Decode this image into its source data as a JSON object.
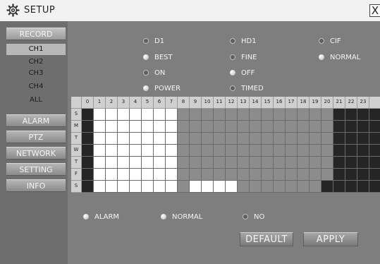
{
  "window": {
    "title": "SETUP",
    "close_glyph": "X"
  },
  "sidebar": {
    "record": "RECORD",
    "channels": [
      "CH1",
      "CH2",
      "CH3",
      "CH4",
      "ALL"
    ],
    "selected_channel": "CH1",
    "menu": [
      "ALARM",
      "PTZ",
      "NETWORK",
      "SETTING",
      "INFO"
    ]
  },
  "options": {
    "resolution": [
      {
        "label": "D1",
        "selected": false
      },
      {
        "label": "HD1",
        "selected": false
      },
      {
        "label": "CIF",
        "selected": false
      }
    ],
    "quality": [
      {
        "label": "BEST",
        "selected": true
      },
      {
        "label": "FINE",
        "selected": false
      },
      {
        "label": "NORMAL",
        "selected": true
      }
    ],
    "audio": [
      {
        "label": "ON",
        "selected": false
      },
      {
        "label": "OFF",
        "selected": true
      }
    ],
    "record_mode": [
      {
        "label": "POWER",
        "selected": true
      },
      {
        "label": "TIMED",
        "selected": false
      }
    ]
  },
  "schedule": {
    "hours": [
      "0",
      "1",
      "2",
      "3",
      "4",
      "5",
      "6",
      "7",
      "8",
      "9",
      "10",
      "11",
      "12",
      "13",
      "14",
      "15",
      "16",
      "17",
      "18",
      "19",
      "20",
      "21",
      "22",
      "23"
    ],
    "days": [
      "S",
      "M",
      "T",
      "W",
      "T",
      "F",
      "S"
    ],
    "rows": [
      "bwwwwwwwgggggggggggggbbbbb",
      "bwwwwwwwgggggggggggggbbbbb",
      "bwwwwwwwgggggggggggggbbbbb",
      "bwwwwwwwgggggggggggggbbbbb",
      "bwwwwwwwgggggggggggggbbbbb",
      "bwwwwwwwgggggggggggggbbbbb",
      "bwwwwwwwgwwwwgggggggbbbbbb"
    ]
  },
  "legend": [
    {
      "label": "ALARM",
      "selected": true
    },
    {
      "label": "NORMAL",
      "selected": true
    },
    {
      "label": "NO",
      "selected": false
    }
  ],
  "buttons": {
    "default": "DEFAULT",
    "apply": "APPLY"
  },
  "colors": {
    "alarm": "#252525",
    "normal": "#8c8c8c",
    "no": "#ffffff"
  },
  "icons": {
    "title": "gear-icon",
    "close": "close-icon"
  }
}
